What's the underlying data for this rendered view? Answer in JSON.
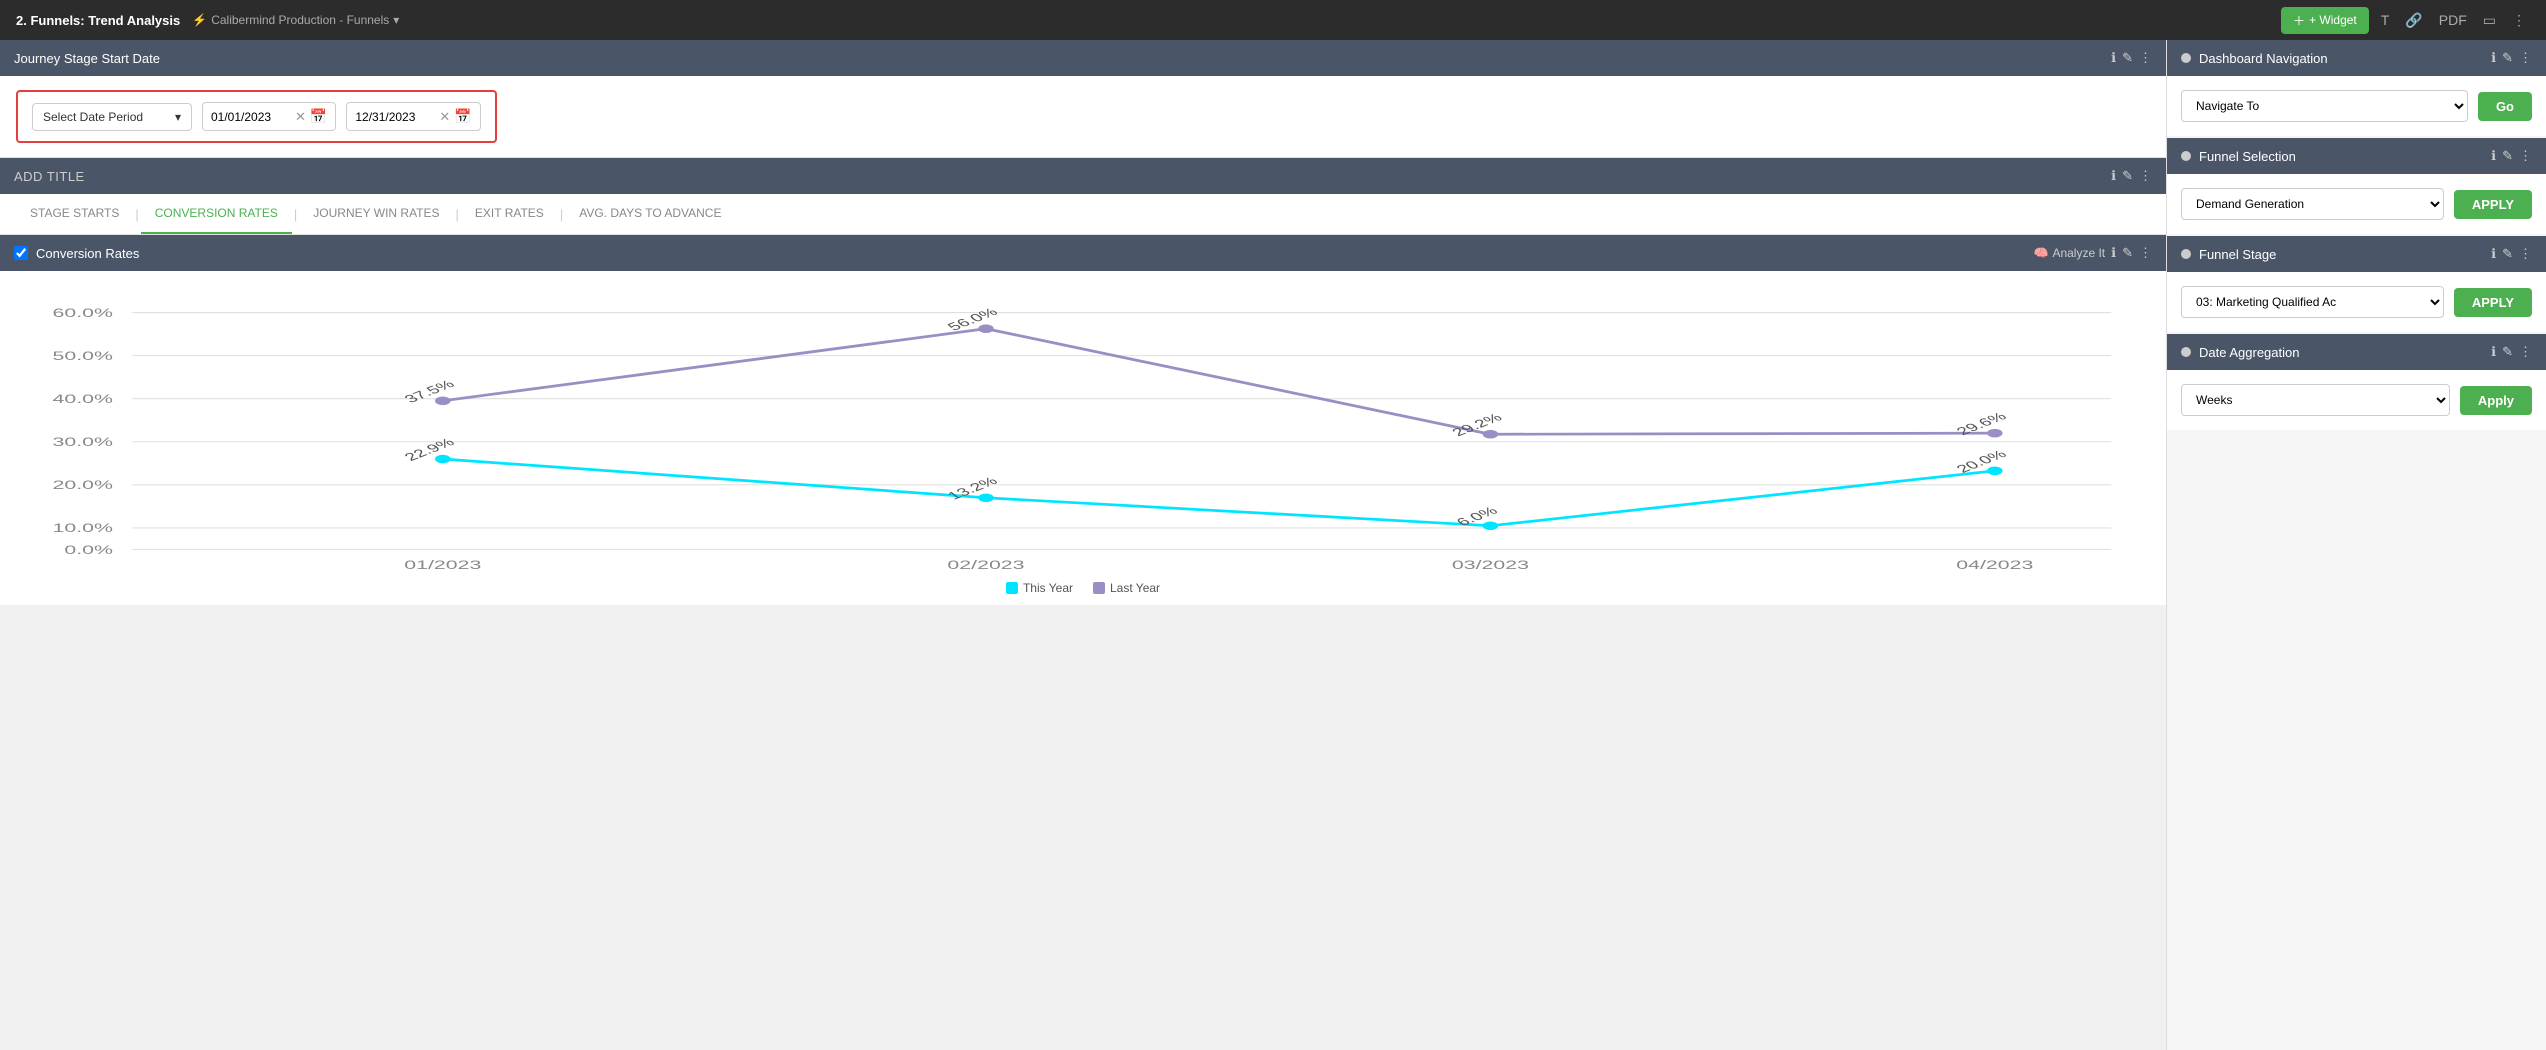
{
  "topNav": {
    "title": "2. Funnels: Trend Analysis",
    "subtitle": "Calibermind Production - Funnels",
    "widgetBtn": "+ Widget"
  },
  "filterSection": {
    "title": "Journey Stage Start Date",
    "dateperiod": {
      "placeholder": "Select Date Period",
      "startDate": "01/01/2023",
      "endDate": "12/31/2023"
    }
  },
  "titleSection": {
    "text": "ADD TITLE"
  },
  "tabs": [
    {
      "label": "STAGE STARTS",
      "active": false
    },
    {
      "label": "CONVERSION RATES",
      "active": true
    },
    {
      "label": "JOURNEY WIN RATES",
      "active": false
    },
    {
      "label": "EXIT RATES",
      "active": false
    },
    {
      "label": "AVG. DAYS TO ADVANCE",
      "active": false
    }
  ],
  "chartSection": {
    "title": "Conversion Rates",
    "analyzeIt": "Analyze It",
    "yAxis": [
      "60.0%",
      "50.0%",
      "40.0%",
      "30.0%",
      "20.0%",
      "10.0%",
      "0.0%"
    ],
    "xAxis": [
      "01/2023",
      "02/2023",
      "03/2023",
      "04/2023"
    ],
    "thisYear": {
      "label": "This Year",
      "color": "#00e5ff",
      "points": [
        22.9,
        13.2,
        6.0,
        20.0
      ],
      "labels": [
        "22.9%",
        "13.2%",
        "6.0%",
        "20.0%"
      ]
    },
    "lastYear": {
      "label": "Last Year",
      "color": "#9b8ec4",
      "points": [
        37.5,
        56.0,
        29.2,
        29.6
      ],
      "labels": [
        "37.5%",
        "56.0%",
        "29.2%",
        "29.6%"
      ]
    }
  },
  "rightPanel": {
    "dashboardNav": {
      "title": "Dashboard Navigation",
      "selectLabel": "Navigate To",
      "goBtn": "Go"
    },
    "funnelSelection": {
      "title": "Funnel Selection",
      "selectValue": "Demand Generation",
      "applyBtn": "APPLY"
    },
    "funnelStage": {
      "title": "Funnel Stage",
      "selectValue": "03: Marketing Qualified Ac",
      "applyBtn": "APPLY"
    },
    "dateAggregation": {
      "title": "Date Aggregation",
      "selectValue": "Weeks",
      "applyBtn": "Apply"
    }
  }
}
